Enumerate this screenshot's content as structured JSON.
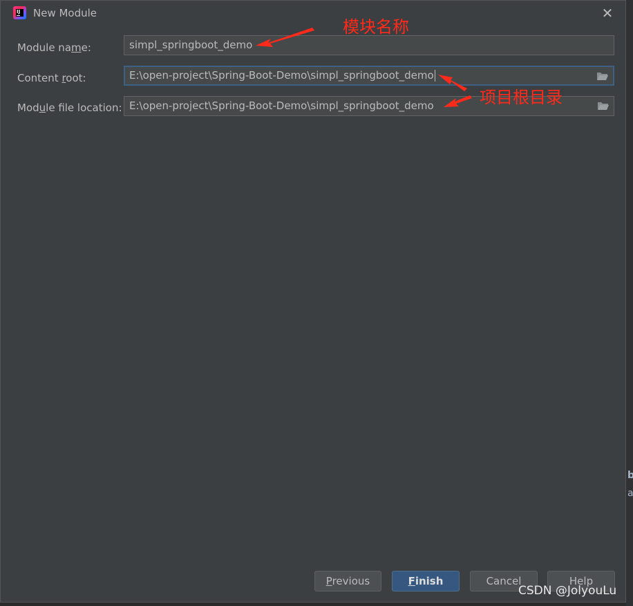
{
  "dialog": {
    "title": "New Module",
    "close_icon": "close-icon"
  },
  "form": {
    "module_name": {
      "label_pre": "Module na",
      "label_ul": "m",
      "label_post": "e:",
      "value": "simpl_springboot_demo"
    },
    "content_root": {
      "label_pre": "Content ",
      "label_ul": "r",
      "label_post": "oot:",
      "value": "E:\\open-project\\Spring-Boot-Demo\\simpl_springboot_demo"
    },
    "module_file_location": {
      "label_pre": "Mod",
      "label_ul": "u",
      "label_post": "le file location:",
      "value": "E:\\open-project\\Spring-Boot-Demo\\simpl_springboot_demo"
    }
  },
  "buttons": {
    "previous_ul": "P",
    "previous_rest": "revious",
    "finish_ul": "F",
    "finish_rest": "inish",
    "cancel": "Cancel",
    "help": "Help"
  },
  "annotations": {
    "module_name_note": "模块名称",
    "project_root_note": "项目根目录"
  },
  "watermark": "CSDN @JolyouLu",
  "colors": {
    "annotation": "#ff2a1a",
    "accent": "#365880"
  }
}
